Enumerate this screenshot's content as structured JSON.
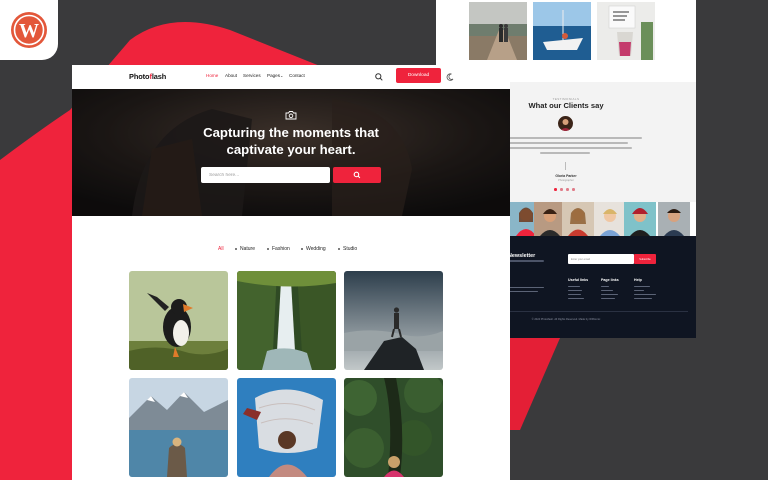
{
  "branding": {
    "badge_icon": "wordpress-logo-icon",
    "accent_color": "#ef233c",
    "badge_color": "#e3573a"
  },
  "main_site": {
    "logo": {
      "prefix": "Photo",
      "accent": "f",
      "suffix": "lash"
    },
    "nav": {
      "items": [
        {
          "label": "Home",
          "active": true
        },
        {
          "label": "About",
          "active": false
        },
        {
          "label": "Services",
          "active": false
        },
        {
          "label": "Pages",
          "active": false,
          "has_dropdown": true
        },
        {
          "label": "Contact",
          "active": false
        }
      ],
      "dropdown_caret": "⌄",
      "search_icon": "search-icon",
      "download_label": "Download",
      "theme_toggle_icon": "moon-icon"
    },
    "hero": {
      "camera_icon": "camera-icon",
      "title_line_1": "Capturing the moments that",
      "title_line_2": "captivate your heart.",
      "search_placeholder": "Search here...",
      "search_button_icon": "search-icon"
    },
    "filters": [
      {
        "label": "All",
        "active": true
      },
      {
        "label": "Nature",
        "active": false
      },
      {
        "label": "Fashion",
        "active": false
      },
      {
        "label": "Wedding",
        "active": false
      },
      {
        "label": "Studio",
        "active": false
      }
    ],
    "gallery": [
      "puffin-photo",
      "waterfall-photo",
      "hiker-on-rock-photo",
      "mountain-lake-photo",
      "woman-with-veil-photo",
      "forest-path-photo"
    ]
  },
  "preview_page": {
    "top_gallery": [
      "couple-walking-photo",
      "sailboat-photo",
      "drink-note-photo"
    ],
    "testimonials": {
      "kicker": "TESTIMONIALS",
      "heading": "What our Clients say",
      "name": "Gloria Parker",
      "role": "Photographer",
      "slider_dots": 4
    },
    "client_strip_count": 7,
    "footer": {
      "newsletter_title": "Newsletter",
      "newsletter_placeholder": "Enter your email",
      "subscribe_label": "Subscribe",
      "columns": [
        "Useful links",
        "Page links",
        "Help"
      ],
      "copyright": "© 2024 Photoflash. All Rights Reserved. Made by WPAsmic"
    }
  }
}
